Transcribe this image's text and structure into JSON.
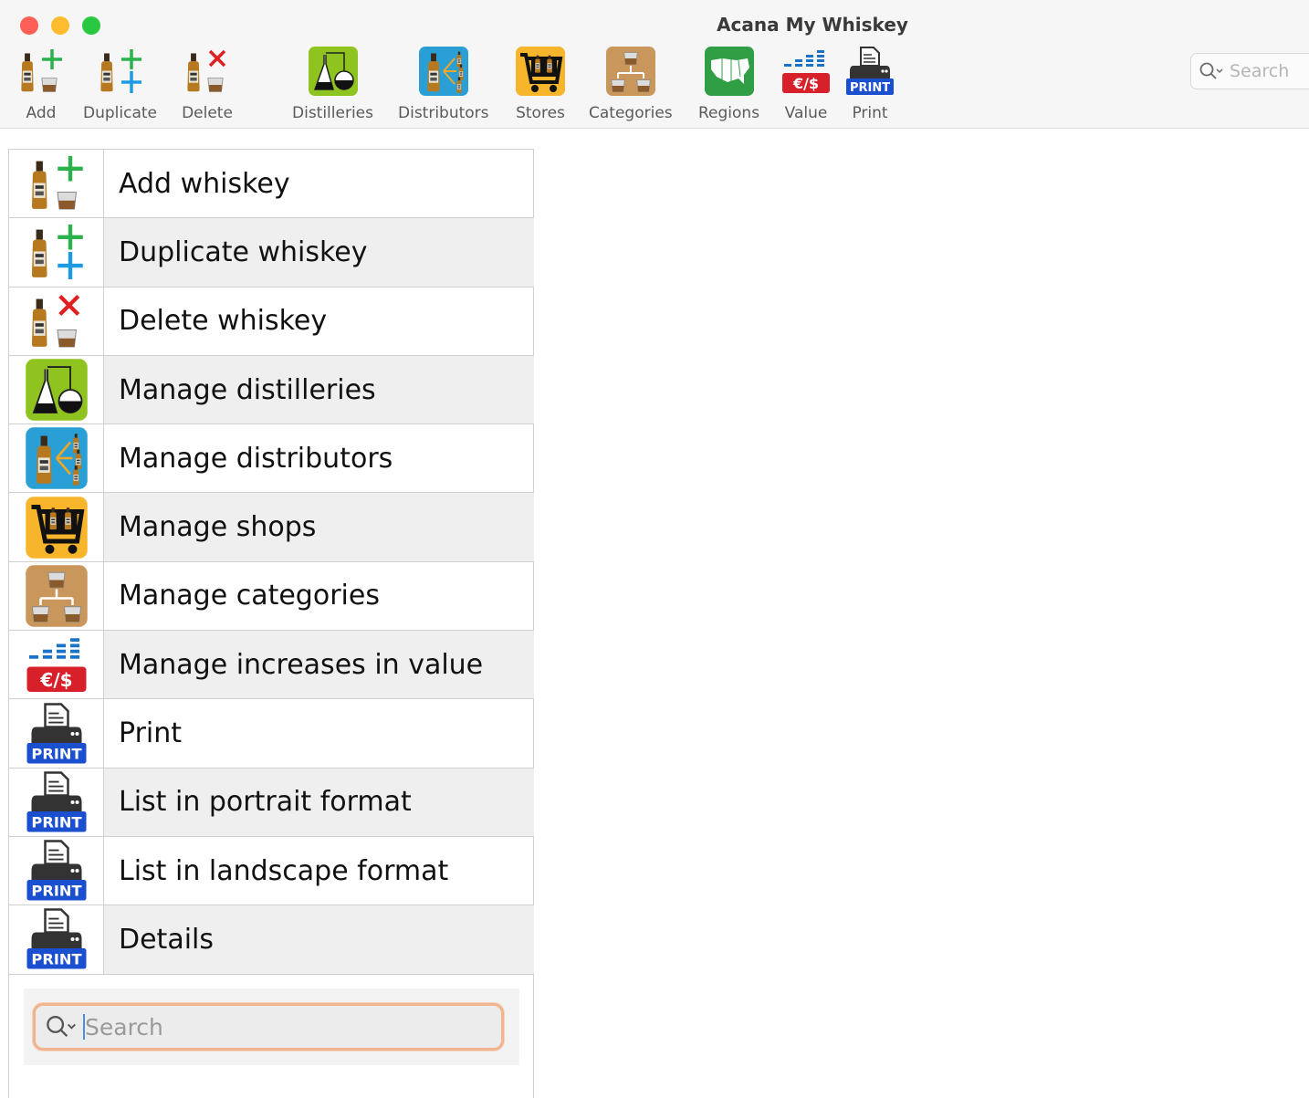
{
  "window": {
    "title": "Acana My Whiskey"
  },
  "toolbar": {
    "items": [
      {
        "label": "Add",
        "icon": "add-whiskey-icon"
      },
      {
        "label": "Duplicate",
        "icon": "duplicate-whiskey-icon"
      },
      {
        "label": "Delete",
        "icon": "delete-whiskey-icon"
      },
      {
        "label": "Distilleries",
        "icon": "distillery-flask-icon"
      },
      {
        "label": "Distributors",
        "icon": "distributors-icon"
      },
      {
        "label": "Stores",
        "icon": "shopping-cart-icon"
      },
      {
        "label": "Categories",
        "icon": "categories-icon"
      },
      {
        "label": "Regions",
        "icon": "regions-map-icon"
      },
      {
        "label": "Value",
        "icon": "value-icon"
      },
      {
        "label": "Print",
        "icon": "print-icon"
      }
    ],
    "search_placeholder": "Search"
  },
  "list": {
    "items": [
      {
        "label": "Add whiskey",
        "icon": "add-whiskey-icon"
      },
      {
        "label": "Duplicate whiskey",
        "icon": "duplicate-whiskey-icon"
      },
      {
        "label": "Delete whiskey",
        "icon": "delete-whiskey-icon"
      },
      {
        "label": "Manage distilleries",
        "icon": "distillery-flask-icon"
      },
      {
        "label": "Manage distributors",
        "icon": "distributors-icon"
      },
      {
        "label": "Manage shops",
        "icon": "shopping-cart-icon"
      },
      {
        "label": "Manage categories",
        "icon": "categories-icon"
      },
      {
        "label": "Manage increases in value",
        "icon": "value-icon"
      },
      {
        "label": "Print",
        "icon": "print-icon"
      },
      {
        "label": "List in portrait format",
        "icon": "print-icon"
      },
      {
        "label": "List in landscape format",
        "icon": "print-icon"
      },
      {
        "label": "Details",
        "icon": "print-icon"
      }
    ],
    "search_placeholder": "Search"
  },
  "icon_texts": {
    "currency": "€/$",
    "print_badge": "PRINT"
  },
  "colors": {
    "traffic_red": "#fe5f57",
    "traffic_yellow": "#febc2e",
    "traffic_green": "#28c840",
    "search_focus": "#f0b48e",
    "row_alt": "#efefef"
  }
}
